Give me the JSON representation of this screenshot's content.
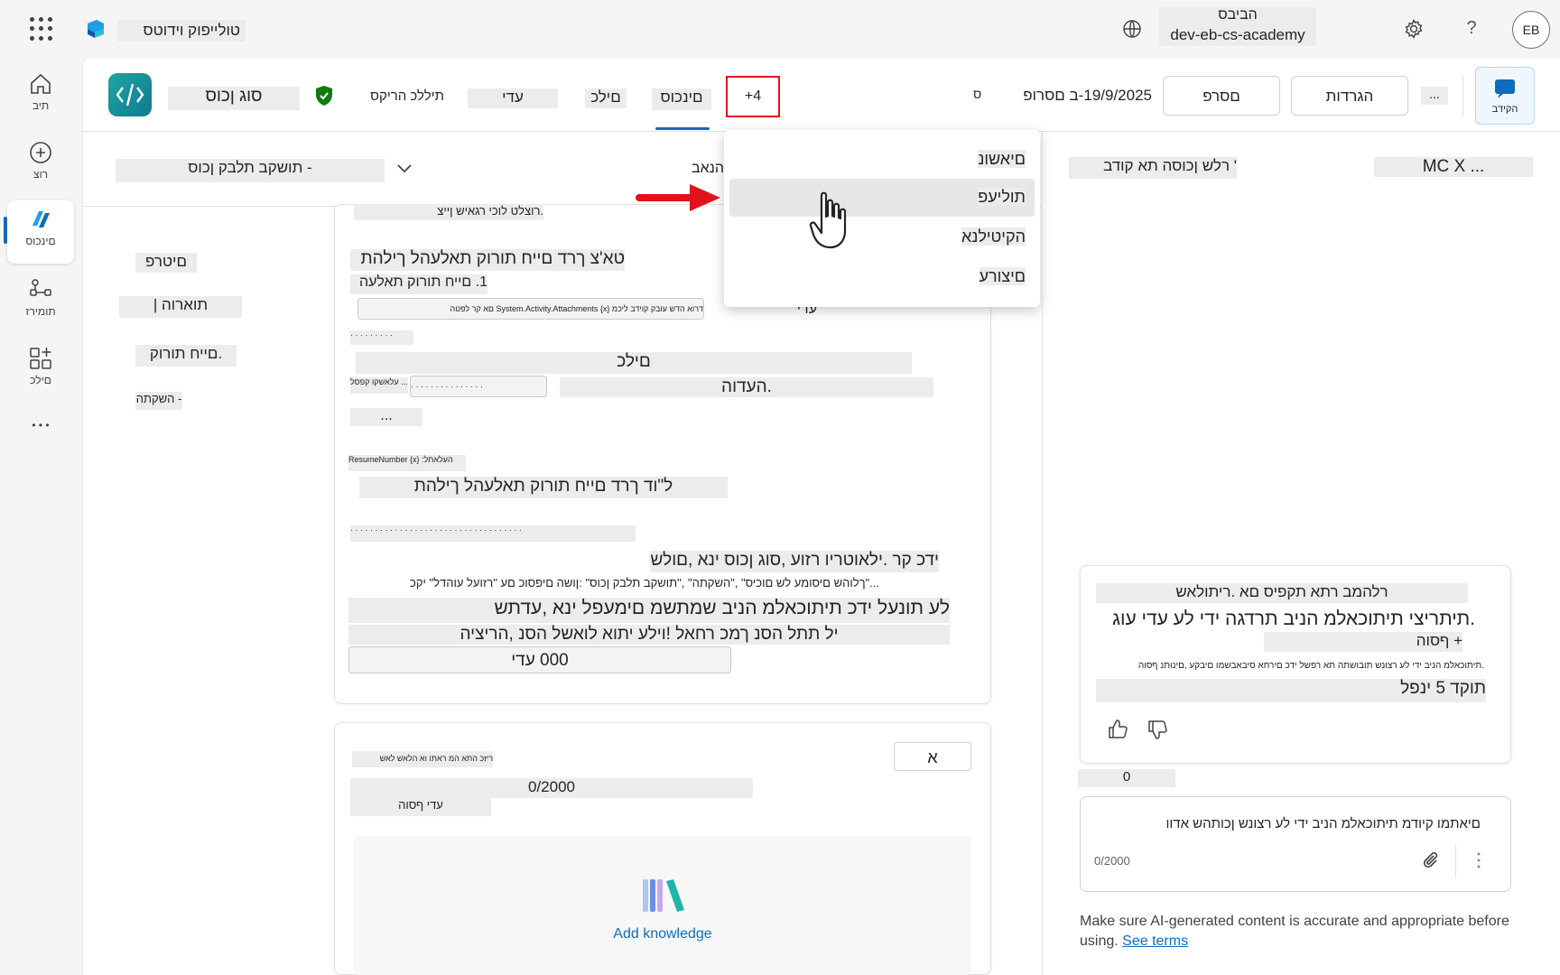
{
  "topbar": {
    "app_title": "טולייפוק וידוטס",
    "env_label": "הביבס",
    "env_name": "dev-eb-cs-academy",
    "avatar_initials": "EB",
    "help": "?"
  },
  "rail": {
    "items": [
      {
        "label": "תיב",
        "icon": "home-icon"
      },
      {
        "label": "רוצ",
        "icon": "plus-circle-icon"
      },
      {
        "label": "םינכוס",
        "icon": "copilot-icon"
      },
      {
        "label": "תומירז",
        "icon": "flow-icon"
      },
      {
        "label": "םילכ",
        "icon": "apps-icon"
      }
    ],
    "more": "• • •"
  },
  "header": {
    "agent_name": "סוג ןכוס",
    "tabs": {
      "settings_hint": "תיללכ הריקס",
      "publish": "עדי",
      "tools": "םילכ",
      "overview": "םינכוס",
      "more": "+4"
    },
    "save_indicator": "ס",
    "saved_date": "19/9/2025-ב םסרופ",
    "publish_btn": "םסרפ",
    "test_btn": "הגרדות",
    "more_btn": "...",
    "agent_btn": "הקידב"
  },
  "subheader": {
    "agent_select": "- תושקב תלבק ןכוס",
    "shortcut": "הנאב"
  },
  "left_nav": {
    "items": [
      "םיטרפ",
      "תוארוה |",
      ".םייח תורוק",
      "- השקתה"
    ]
  },
  "dropdown": {
    "items": [
      "םיאשונ",
      "תוליעפ",
      "הקיטילנא",
      "םיצורע"
    ]
  },
  "card1": {
    "line1": ".רוצלט לוכי רגאיש ןייצ",
    "heading": "טא'צ ךרד םייח תורוק תאלעהל ךילהת",
    "step1": "1. םייח תורוק תאלעה",
    "expr": "דרוא הדש עובק קוידב ליכמ {x} System.Activity.Attachments םא קר לפטה",
    "know_label": "עדי",
    "tiny1": "· · · · · · · · ·",
    "tools_label": "םילכ",
    "tiny2": "עלאשקו קפסל ...",
    "chip": "· · · · · · · · · · · · · · ·",
    "notice": ".העדוה",
    "ellipsis": "...",
    "tiny3": "ResumeNumber {x} :העלאתל",
    "heading2": "ל\"וד ךרד םייח תורוק תאלעהל ךילהת",
    "tiny4": "· · · · · · · · · · · · · · · · · · · · · · · · · · · · · · · · · · ·",
    "line_hello": "ידכ קר .ילאוטריו רזוע ,סוג ןכוס ינא ,םולש",
    "line_topics": "...\"ךלוהש םיסומע לש םוכיס\" ,\"השקתה\" ,\"תושקב תלבק ןכוס\" :ןושה םיפסוכ םע \"רזועל עוהדל\" יקכ",
    "line_assist": "לע תונעל ידכ תיתוכאלמ הניב שמתשמ םימעפל ינא ,עדתש",
    "line_warn": "יל תתל הסנ ךמכ רחאל !וילע יתוא לואשל הסנ ,הריציה",
    "know_count": "000 עדי"
  },
  "card2": {
    "badge": "א",
    "hint": "ריזכ התא המ ראתו וא הלאש לאש",
    "counter": "0/2000",
    "section": "עדי ףסוה",
    "add_knowledge": "Add knowledge"
  },
  "test_panel": {
    "title": "' רלש ןכוסה תא קודב",
    "name": "MC X ...",
    "resp_line1": "רלהמב רתא תקפיס םא .ריתולאש",
    "resp_line2": ".תיתריצי תיתוכאלמ הניב תרדגה ידי לע עדי עוג",
    "resp_line3": "+ ףסוה",
    "resp_line4": ".תיתוכאלמ הניב ידי לע רצונש תובושתה תא רפשל ידכ םירחא סיבאבשמו םיבקע ,םינותנ ףסוה",
    "resp_line5": "תוקד 5 ינפל",
    "count": "0",
    "input_placeholder": "םיאתמו קיודמ תיתוכאלמ הניב ידי לע רצונש ןכותהש אדוו",
    "input_counter": "0/2000",
    "disclaimer": "Make sure AI-generated content is accurate and appropriate before using.",
    "see_terms": "See terms"
  },
  "colors": {
    "accent": "#0f6cbd",
    "highlight_border": "#e3111b",
    "shield": "#107c10"
  }
}
